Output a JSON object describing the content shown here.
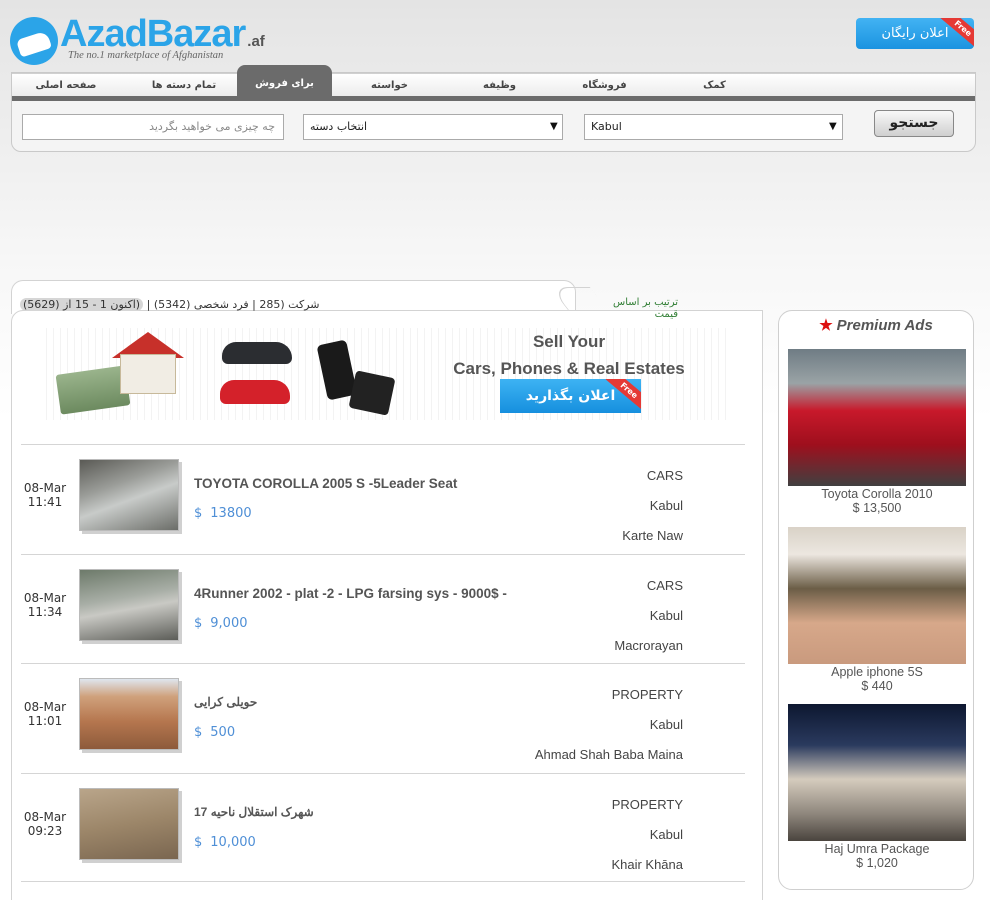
{
  "header": {
    "logo_text": "AzadBazar",
    "logo_domain": ".af",
    "tagline": "The no.1 marketplace of Afghanistan",
    "free_post_label": "اعلان رایگان",
    "free_ribbon": "Free"
  },
  "nav": {
    "tabs": [
      {
        "label": "صفحه اصلی",
        "active": false
      },
      {
        "label": "تمام دسته ها",
        "active": false
      },
      {
        "label": "برای فروش",
        "active": true
      },
      {
        "label": "خواسته",
        "active": false
      },
      {
        "label": "وظیفه",
        "active": false
      },
      {
        "label": "فروشگاه",
        "active": false
      },
      {
        "label": "کمک",
        "active": false
      }
    ]
  },
  "search": {
    "placeholder": "چه چیزی می خواهید بگردید",
    "category_value": "انتخاب دسته",
    "location_value": "Kabul",
    "button_label": "جستجو"
  },
  "listing_filters": {
    "company": "شرکت (285",
    "separator": "|",
    "individual": "فرد شخصی (5342)",
    "range": "(اکنون 1 - 15 از (5629)",
    "sort_label": "ترتیب بر اساس قیمت"
  },
  "banner": {
    "line1": "Sell Your",
    "line2": "Cars, Phones & Real Estates here!",
    "cta": "اعلان بگذارید",
    "ribbon": "Free"
  },
  "listings": [
    {
      "day": "08-Mar",
      "time": "11:41",
      "title": "TOYOTA COROLLA 2005 S -5Leader Seat",
      "currency": "$",
      "price": "13800",
      "category": "CARS",
      "city": "Kabul",
      "area": "Karte Naw"
    },
    {
      "day": "08-Mar",
      "time": "11:34",
      "title": "4Runner 2002 - plat -2 - LPG farsing sys - 9000$ -",
      "currency": "$",
      "price": "9,000",
      "category": "CARS",
      "city": "Kabul",
      "area": "Macrorayan"
    },
    {
      "day": "08-Mar",
      "time": "11:01",
      "title": "حویلی کرایی",
      "currency": "$",
      "price": "500",
      "category": "PROPERTY",
      "city": "Kabul",
      "area": "Ahmad Shah Baba Maina"
    },
    {
      "day": "08-Mar",
      "time": "09:23",
      "title": "شهرک استقلال ناحیه 17",
      "currency": "$",
      "price": "10,000",
      "category": "PROPERTY",
      "city": "Kabul",
      "area": "Khair Khāna"
    }
  ],
  "premium": {
    "title": "Premium Ads",
    "items": [
      {
        "name": "Toyota Corolla 2010",
        "price": "$ 13,500"
      },
      {
        "name": "Apple iphone 5S",
        "price": "$ 440"
      },
      {
        "name": "Haj Umra Package",
        "price": "$ 1,020"
      }
    ]
  }
}
